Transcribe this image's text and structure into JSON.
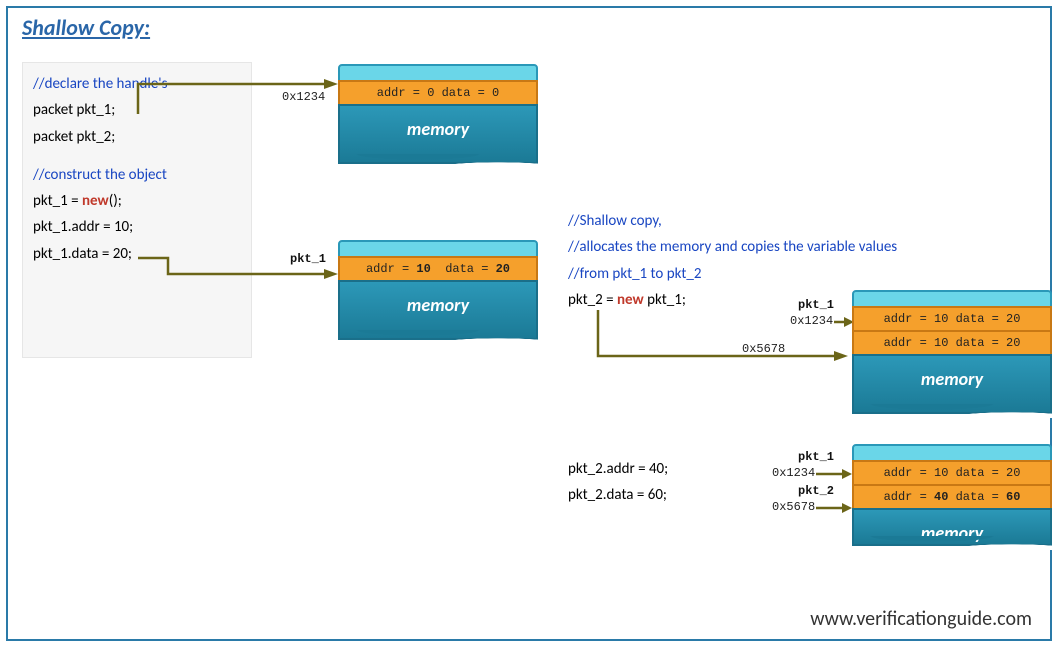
{
  "title": "Shallow Copy:",
  "code": {
    "c1": "//declare the handle's",
    "l1": "packet pkt_1;",
    "l2": "packet pkt_2;",
    "c2": "//construct the object",
    "l3_pre": "pkt_1 = ",
    "l3_kw": "new",
    "l3_post": "();",
    "l4": "pkt_1.addr = 10;",
    "l5": "pkt_1.data = 20;"
  },
  "mem1": {
    "row": "addr = 0   data = 0",
    "label": "memory",
    "ptr_addr": "0x1234"
  },
  "mem2": {
    "row_html": "addr = 10   data = 20",
    "label": "memory",
    "ptr_name": "pkt_1"
  },
  "right1": {
    "c1": "//Shallow copy,",
    "c2": "//allocates the memory and copies the variable values",
    "c3": "//from pkt_1 to pkt_2",
    "l1_pre": "pkt_2 = ",
    "l1_kw": "new",
    "l1_post": " pkt_1;"
  },
  "mem3": {
    "row1": "addr = 10   data = 20",
    "row2": "addr = 10   data = 20",
    "label": "memory",
    "ptr1_name": "pkt_1",
    "ptr1_addr": "0x1234",
    "ptr2_addr": "0x5678"
  },
  "right2": {
    "l1": "pkt_2.addr = 40;",
    "l2": "pkt_2.data = 60;"
  },
  "mem4": {
    "row1": "addr = 10   data = 20",
    "row2_pre": "addr = ",
    "row2_v1": "40",
    "row2_mid": "   data = ",
    "row2_v2": "60",
    "label": "memory",
    "ptr1_name": "pkt_1",
    "ptr1_addr": "0x1234",
    "ptr2_name": "pkt_2",
    "ptr2_addr": "0x5678"
  },
  "footer": "www.verificationguide.com"
}
